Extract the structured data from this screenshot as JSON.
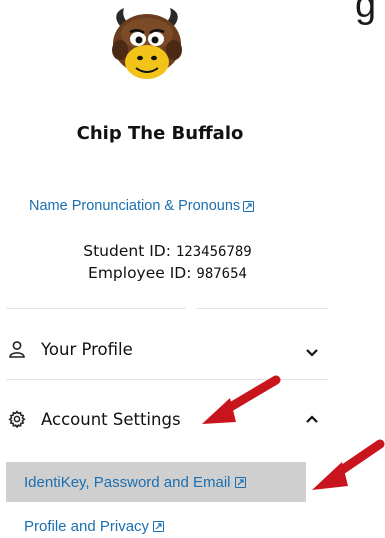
{
  "stray_char": "g",
  "profile": {
    "name": "Chip The Buffalo",
    "pronunciation_link": "Name Pronunciation & Pronouns",
    "student_id_label": "Student ID:",
    "student_id": "123456789",
    "employee_id_label": "Employee ID:",
    "employee_id": "987654"
  },
  "sections": [
    {
      "label": "Your Profile",
      "icon": "person-icon",
      "state": "collapsed"
    },
    {
      "label": "Account Settings",
      "icon": "gear-icon",
      "state": "expanded"
    }
  ],
  "account_settings_items": [
    {
      "label": "IdentiKey, Password and Email",
      "selected": true
    },
    {
      "label": "Profile and Privacy",
      "selected": false
    }
  ],
  "colors": {
    "link": "#1c6fb0",
    "selected_bg": "#cfcfcf",
    "annotation_arrow": "#c8141c"
  }
}
